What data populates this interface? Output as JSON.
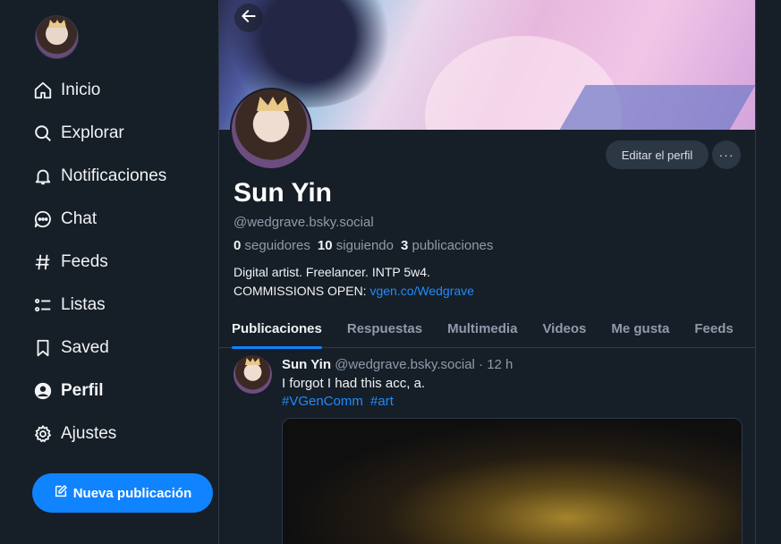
{
  "sidebar": {
    "items": [
      {
        "label": "Inicio",
        "icon": "home-icon"
      },
      {
        "label": "Explorar",
        "icon": "search-icon"
      },
      {
        "label": "Notificaciones",
        "icon": "bell-icon"
      },
      {
        "label": "Chat",
        "icon": "chat-icon"
      },
      {
        "label": "Feeds",
        "icon": "hash-icon"
      },
      {
        "label": "Listas",
        "icon": "list-icon"
      },
      {
        "label": "Saved",
        "icon": "bookmark-icon"
      },
      {
        "label": "Perfil",
        "icon": "user-icon"
      },
      {
        "label": "Ajustes",
        "icon": "gear-icon"
      }
    ],
    "new_post_label": "Nueva publicación"
  },
  "profile": {
    "edit_label": "Editar el perfil",
    "more_label": "···",
    "display_name": "Sun Yin",
    "handle": "@wedgrave.bsky.social",
    "stats": {
      "followers_count": "0",
      "followers_label": "seguidores",
      "following_count": "10",
      "following_label": "siguiendo",
      "posts_count": "3",
      "posts_label": "publicaciones"
    },
    "bio_line1": "Digital artist. Freelancer. INTP 5w4.",
    "bio_line2_prefix": "COMMISSIONS OPEN: ",
    "bio_link": "vgen.co/Wedgrave"
  },
  "tabs": [
    "Publicaciones",
    "Respuestas",
    "Multimedia",
    "Videos",
    "Me gusta",
    "Feeds"
  ],
  "post": {
    "name": "Sun Yin",
    "handle": "@wedgrave.bsky.social",
    "time": "· 12 h",
    "text": "I forgot I had this acc, a.",
    "tags": [
      "#VGenComm",
      "#art"
    ]
  },
  "colors": {
    "background": "#161e27",
    "accent": "#1083fe",
    "link": "#208bfe",
    "muted_text": "#8f9bab"
  }
}
